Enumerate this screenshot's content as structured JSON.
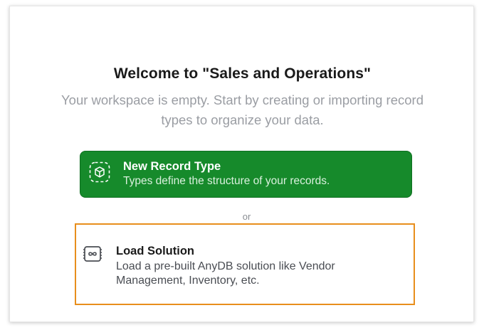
{
  "welcome": {
    "title": "Welcome to \"Sales and Operations\"",
    "subtitle": "Your workspace is empty. Start by creating or importing record types to organize your data."
  },
  "new_record_type": {
    "label": "New Record Type",
    "description": "Types define the structure of your records.",
    "icon": "dashed-cube-icon",
    "color": "#168a2b"
  },
  "separator": {
    "text": "or"
  },
  "load_solution": {
    "label": "Load Solution",
    "description": "Load a pre-built AnyDB solution like Vendor Management, Inventory, etc.",
    "icon": "solution-chip-icon",
    "highlight_color": "#e88e1c"
  }
}
